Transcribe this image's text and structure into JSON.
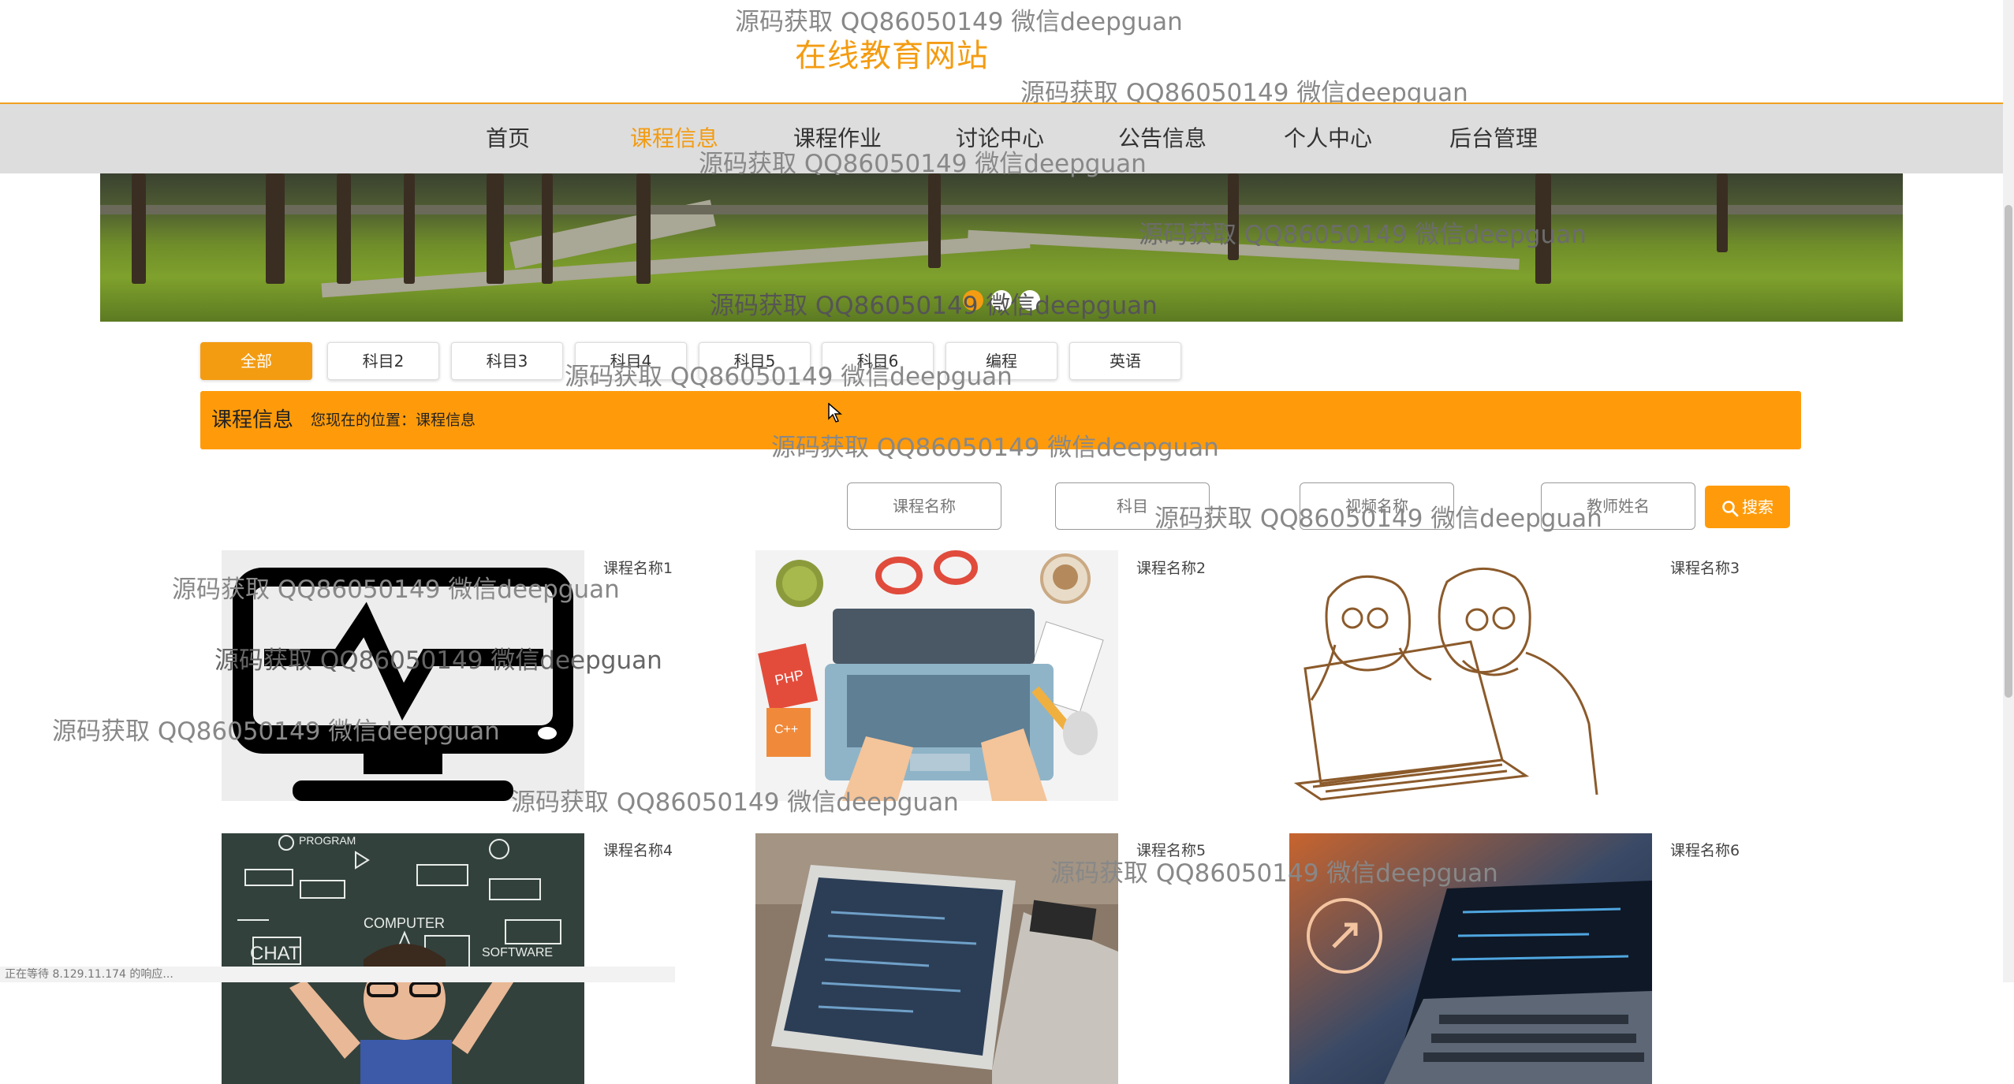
{
  "header": {
    "site_title": "在线教育网站"
  },
  "nav": {
    "items": [
      {
        "label": "首页",
        "active": false
      },
      {
        "label": "课程信息",
        "active": true
      },
      {
        "label": "课程作业",
        "active": false
      },
      {
        "label": "讨论中心",
        "active": false
      },
      {
        "label": "公告信息",
        "active": false
      },
      {
        "label": "个人中心",
        "active": false
      },
      {
        "label": "后台管理",
        "active": false
      }
    ]
  },
  "category_tabs": [
    {
      "label": "全部",
      "active": true
    },
    {
      "label": "科目2",
      "active": false
    },
    {
      "label": "科目3",
      "active": false
    },
    {
      "label": "科目4",
      "active": false
    },
    {
      "label": "科目5",
      "active": false
    },
    {
      "label": "科目6",
      "active": false
    },
    {
      "label": "编程",
      "active": false
    },
    {
      "label": "英语",
      "active": false
    }
  ],
  "section": {
    "title": "课程信息",
    "location": "您现在的位置：课程信息"
  },
  "search": {
    "course_name_placeholder": "课程名称",
    "subject_placeholder": "科目",
    "video_name_placeholder": "视频名称",
    "teacher_placeholder": "教师姓名",
    "button_label": "搜索"
  },
  "courses": [
    {
      "name": "课程名称1",
      "image": "monitor-icon"
    },
    {
      "name": "课程名称2",
      "image": "laptop-desk-illustration"
    },
    {
      "name": "课程名称3",
      "image": "sketch-people-laptop"
    },
    {
      "name": "课程名称4",
      "image": "chalkboard-kid-photo"
    },
    {
      "name": "课程名称5",
      "image": "laptop-photo"
    },
    {
      "name": "课程名称6",
      "image": "laptop-code-photo"
    }
  ],
  "watermark": "源码获取 QQ86050149 微信deepguan",
  "status_bar": "正在等待 8.129.11.174 的响应..."
}
